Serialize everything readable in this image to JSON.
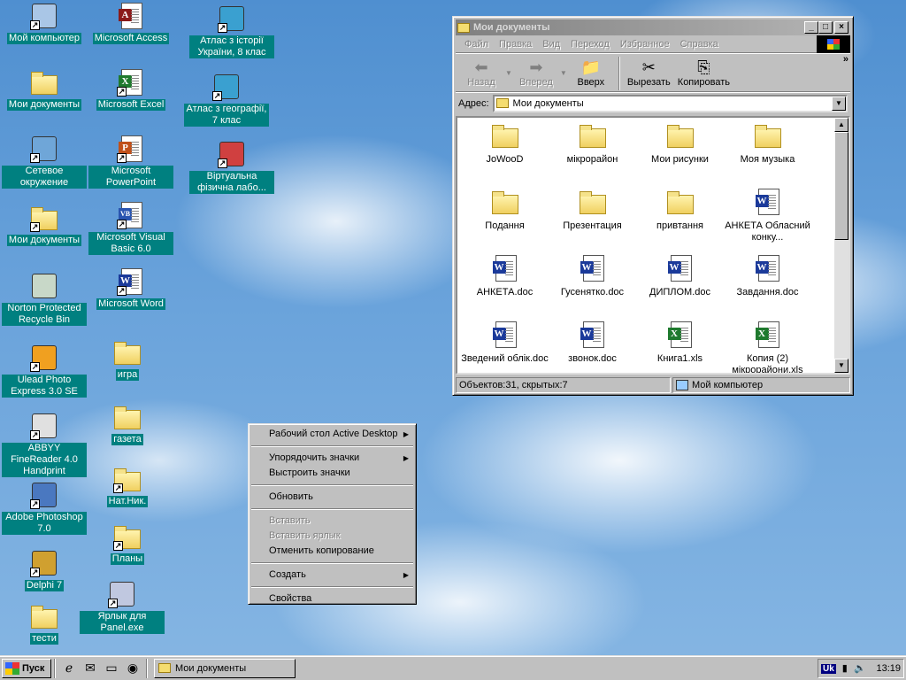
{
  "desktop": {
    "icons": [
      {
        "label": "Мой компьютер",
        "icon": "my-computer-icon"
      },
      {
        "label": "Мои документы",
        "icon": "folder-icon"
      },
      {
        "label": "Сетевое окружение",
        "icon": "network-icon"
      },
      {
        "label": "Мои документы",
        "icon": "folder-icon"
      },
      {
        "label": "Norton Protected Recycle Bin",
        "icon": "recycle-bin-icon"
      },
      {
        "label": "Ulead Photo Express 3.0 SE",
        "icon": "ulead-icon"
      },
      {
        "label": "ABBYY FineReader 4.0 Handprint",
        "icon": "finereader-icon"
      },
      {
        "label": "Adobe Photoshop 7.0",
        "icon": "photoshop-icon"
      },
      {
        "label": "Delphi 7",
        "icon": "delphi-icon"
      },
      {
        "label": "тести",
        "icon": "folder-icon"
      },
      {
        "label": "Microsoft Access",
        "icon": "access-icon"
      },
      {
        "label": "Microsoft Excel",
        "icon": "excel-icon"
      },
      {
        "label": "Microsoft PowerPoint",
        "icon": "powerpoint-icon"
      },
      {
        "label": "Microsoft Visual Basic 6.0",
        "icon": "visual-basic-icon"
      },
      {
        "label": "Microsoft Word",
        "icon": "word-icon"
      },
      {
        "label": "игра",
        "icon": "folder-icon"
      },
      {
        "label": "газета",
        "icon": "folder-icon"
      },
      {
        "label": "Нат.Ник.",
        "icon": "folder-icon"
      },
      {
        "label": "Планы",
        "icon": "folder-icon"
      },
      {
        "label": "Ярлык для Panel.exe",
        "icon": "scanner-icon"
      },
      {
        "label": "Атлас з історії України, 8 клас",
        "icon": "atlas-globe-icon"
      },
      {
        "label": "Атлас з географії, 7 клас",
        "icon": "atlas-globe-icon"
      },
      {
        "label": "Віртуальна фізична лабо...",
        "icon": "physics-lab-icon"
      }
    ]
  },
  "window": {
    "title": "Мои документы",
    "menu": [
      "Файл",
      "Правка",
      "Вид",
      "Переход",
      "Избранное",
      "Справка"
    ],
    "toolbar": {
      "back": "Назад",
      "forward": "Вперед",
      "up": "Вверх",
      "cut": "Вырезать",
      "copy": "Копировать"
    },
    "address_label": "Адрес:",
    "address_value": "Мои документы",
    "files": [
      {
        "name": "JoWooD",
        "type": "folder"
      },
      {
        "name": "мікрорайон",
        "type": "folder"
      },
      {
        "name": "Мои рисунки",
        "type": "folder"
      },
      {
        "name": "Моя музыка",
        "type": "folder"
      },
      {
        "name": "Подання",
        "type": "folder"
      },
      {
        "name": "Презентация",
        "type": "folder"
      },
      {
        "name": "привтання",
        "type": "folder"
      },
      {
        "name": "АНКЕТА Обласний конку...",
        "type": "word"
      },
      {
        "name": "АНКЕТА.doc",
        "type": "word"
      },
      {
        "name": "Гусенятко.doc",
        "type": "word"
      },
      {
        "name": "ДИПЛОМ.doc",
        "type": "word"
      },
      {
        "name": "Завдання.doc",
        "type": "word"
      },
      {
        "name": "Зведений облік.doc",
        "type": "word"
      },
      {
        "name": "звонок.doc",
        "type": "word"
      },
      {
        "name": "Книга1.xls",
        "type": "excel"
      },
      {
        "name": "Копия (2) мікрорайони.xls",
        "type": "excel"
      }
    ],
    "status_left": "Объектов:31, скрытых:7",
    "status_right": "Мой компьютер"
  },
  "context_menu": {
    "items": [
      {
        "label": "Рабочий стол Active Desktop",
        "submenu": true,
        "disabled": false
      },
      {
        "sep": true
      },
      {
        "label": "Упорядочить значки",
        "submenu": true,
        "disabled": false
      },
      {
        "label": "Выстроить значки",
        "submenu": false,
        "disabled": false
      },
      {
        "sep": true
      },
      {
        "label": "Обновить",
        "submenu": false,
        "disabled": false
      },
      {
        "sep": true
      },
      {
        "label": "Вставить",
        "submenu": false,
        "disabled": true
      },
      {
        "label": "Вставить ярлык",
        "submenu": false,
        "disabled": true
      },
      {
        "label": "Отменить копирование",
        "submenu": false,
        "disabled": false
      },
      {
        "sep": true
      },
      {
        "label": "Создать",
        "submenu": true,
        "disabled": false
      },
      {
        "sep": true
      },
      {
        "label": "Свойства",
        "submenu": false,
        "disabled": false
      }
    ]
  },
  "taskbar": {
    "start_label": "Пуск",
    "task_label": "Мои документы",
    "lang": "Uk",
    "clock": "13:19"
  },
  "colors": {
    "icon_label_bg": "#008080",
    "window_face": "#c0c0c0",
    "inactive_title": "#808080"
  }
}
